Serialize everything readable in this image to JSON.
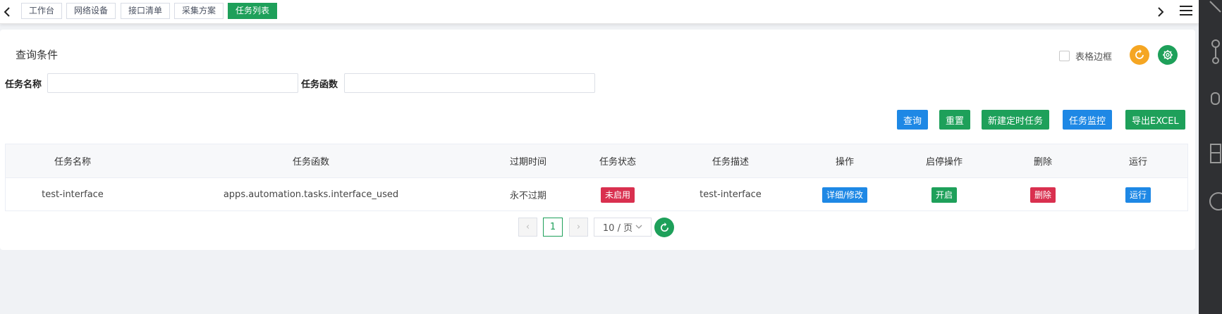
{
  "tabs": [
    {
      "label": "工作台"
    },
    {
      "label": "网络设备"
    },
    {
      "label": "接口清单"
    },
    {
      "label": "采集方案"
    },
    {
      "label": "任务列表"
    }
  ],
  "colors": {
    "green": "#1ea05a",
    "blue": "#1e88e5",
    "red": "#d9304f",
    "orange": "#f5a623"
  },
  "query": {
    "title": "查询条件",
    "border_toggle_label": "表格边框",
    "fields": [
      {
        "label": "任务名称",
        "value": "",
        "placeholder": ""
      },
      {
        "label": "任务函数",
        "value": "",
        "placeholder": ""
      }
    ]
  },
  "actions": [
    {
      "label": "查询"
    },
    {
      "label": "重置"
    },
    {
      "label": "新建定时任务"
    },
    {
      "label": "任务监控"
    },
    {
      "label": "导出EXCEL"
    }
  ],
  "table": {
    "columns": [
      "任务名称",
      "任务函数",
      "过期时间",
      "任务状态",
      "任务描述",
      "操作",
      "启停操作",
      "删除",
      "运行"
    ],
    "rows": [
      {
        "name": "test-interface",
        "func": "apps.automation.tasks.interface_used",
        "expire": "永不过期",
        "status": "未启用",
        "desc": "test-interface",
        "op": "详细/修改",
        "toggle": "开启",
        "delete": "删除",
        "run": "运行"
      }
    ]
  },
  "pagination": {
    "prev": "‹",
    "page": "1",
    "next": "›",
    "size": "10 / 页"
  },
  "icons": [
    "chevron-left-icon",
    "chevron-right-icon",
    "menu-icon",
    "refresh-icon",
    "gear-icon",
    "chevron-down-icon"
  ]
}
